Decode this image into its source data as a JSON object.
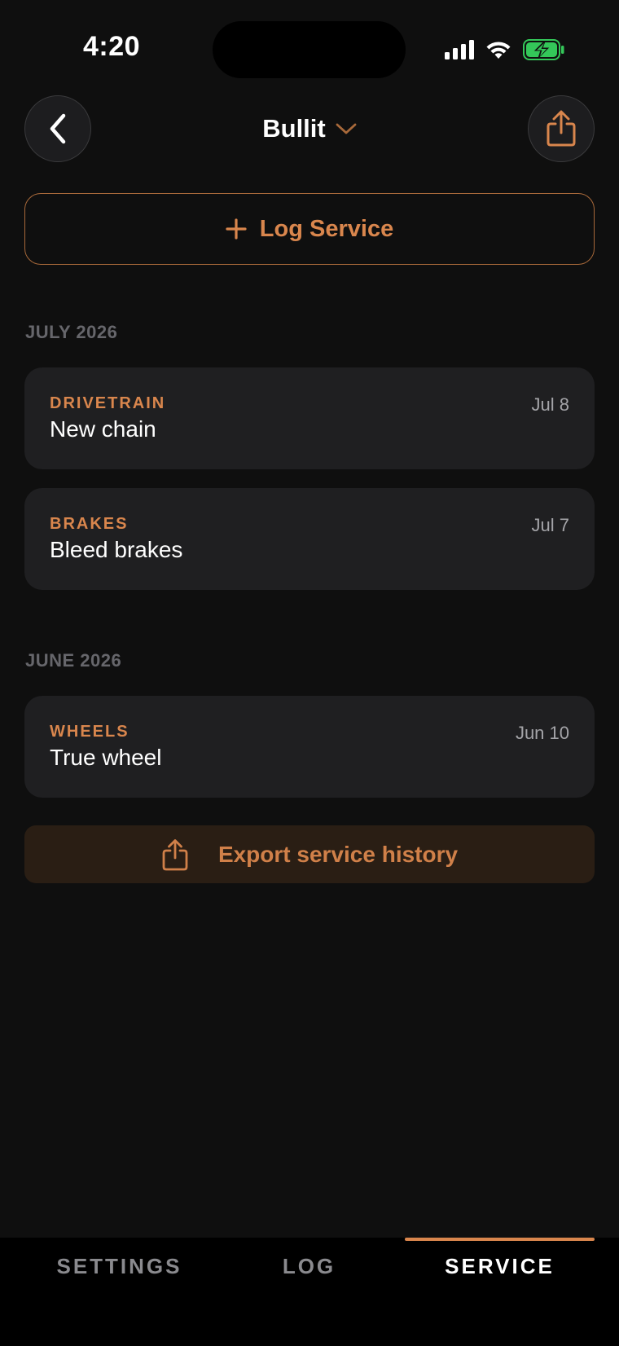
{
  "status_bar": {
    "time": "4:20"
  },
  "header": {
    "title": "Bullit",
    "back_icon": "chevron-left-icon",
    "share_icon": "share-icon",
    "dropdown_icon": "chevron-down-icon"
  },
  "log_button": {
    "label": "Log Service",
    "icon": "plus-icon"
  },
  "sections": [
    {
      "header": "JULY 2026",
      "items": [
        {
          "category": "DRIVETRAIN",
          "title": "New chain",
          "date": "Jul 8"
        },
        {
          "category": "BRAKES",
          "title": "Bleed brakes",
          "date": "Jul 7"
        }
      ]
    },
    {
      "header": "JUNE 2026",
      "items": [
        {
          "category": "WHEELS",
          "title": "True wheel",
          "date": "Jun 10"
        }
      ]
    }
  ],
  "export_button": {
    "label": "Export service history",
    "icon": "share-icon"
  },
  "tabs": [
    {
      "label": "SETTINGS",
      "active": false
    },
    {
      "label": "LOG",
      "active": false
    },
    {
      "label": "SERVICE",
      "active": true
    }
  ],
  "colors": {
    "accent": "#d9864d",
    "background": "#0f0f0f",
    "card": "#1f1f21",
    "battery": "#34c759"
  }
}
